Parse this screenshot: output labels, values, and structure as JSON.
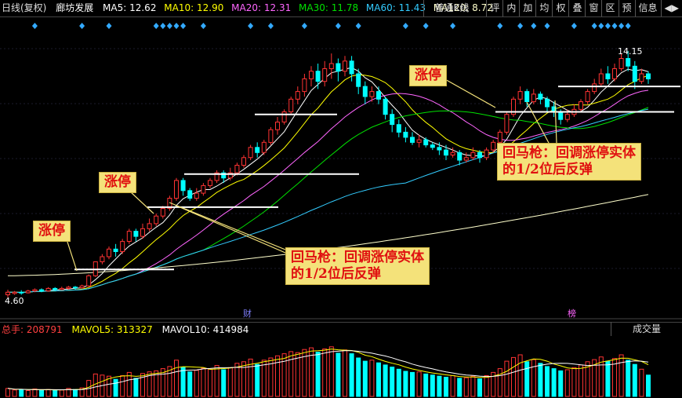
{
  "header": {
    "chart_mode": "日线(复权)",
    "stock_name": "廊坊发展",
    "ma_legend": [
      {
        "label": "MA5: 12.62",
        "color": "#ffffff"
      },
      {
        "label": "MA10: 12.90",
        "color": "#ffff00"
      },
      {
        "label": "MA20: 12.31",
        "color": "#ff66ff"
      },
      {
        "label": "MA30: 11.78",
        "color": "#00e000"
      },
      {
        "label": "MA60: 11.43",
        "color": "#33ccff"
      },
      {
        "label": "MA120: 8.72",
        "color": "#ffffcc"
      }
    ]
  },
  "toolbar": {
    "select_label": "普通K线",
    "select_icon": "caret-down-icon",
    "buttons": [
      "评",
      "内",
      "加",
      "均",
      "权",
      "叠",
      "窗",
      "区",
      "预",
      "信息"
    ],
    "arrows_label": "◀▶"
  },
  "annotations": {
    "limit_up_1": "涨停",
    "limit_up_2": "涨停",
    "limit_up_3": "涨停",
    "pullback_1_line1": "回马枪：回调涨停实体",
    "pullback_1_line2": "的1/2位后反弹",
    "pullback_2_line1": "回马枪：回调涨停实体",
    "pullback_2_line2": "的1/2位后反弹"
  },
  "volume_header": {
    "total_label": "总手: 208791",
    "mavol5_label": "MAVOL5: 313327",
    "mavol10_label": "MAVOL10: 414984",
    "select_label": "成交量"
  },
  "chart_data": {
    "type": "candlestick",
    "price_range": [
      4.6,
      15.6
    ],
    "max_label": "14.15",
    "min_label": "4.60",
    "event_markers": [
      "财",
      "榜"
    ],
    "colors": {
      "up": "#ff3333",
      "down": "#00ffff"
    },
    "candles": [
      [
        4.8,
        4.9,
        4.7,
        5.0
      ],
      [
        4.85,
        4.9,
        4.8,
        4.95
      ],
      [
        4.9,
        4.88,
        4.8,
        4.98
      ],
      [
        4.88,
        4.95,
        4.85,
        5.0
      ],
      [
        4.95,
        5.0,
        4.9,
        5.05
      ],
      [
        5.0,
        4.95,
        4.9,
        5.05
      ],
      [
        4.95,
        5.05,
        4.92,
        5.1
      ],
      [
        5.05,
        5.0,
        4.95,
        5.1
      ],
      [
        5.0,
        5.05,
        4.98,
        5.12
      ],
      [
        5.05,
        5.1,
        5.0,
        5.15
      ],
      [
        5.1,
        5.08,
        5.0,
        5.15
      ],
      [
        5.08,
        5.15,
        5.05,
        5.2
      ],
      [
        5.15,
        5.55,
        5.1,
        5.6
      ],
      [
        5.55,
        6.1,
        5.5,
        6.1
      ],
      [
        6.1,
        6.3,
        6.0,
        6.4
      ],
      [
        6.3,
        6.6,
        6.2,
        6.7
      ],
      [
        6.6,
        6.5,
        6.3,
        6.8
      ],
      [
        6.5,
        6.9,
        6.4,
        7.0
      ],
      [
        6.9,
        7.3,
        6.8,
        7.4
      ],
      [
        7.3,
        7.1,
        6.9,
        7.4
      ],
      [
        7.1,
        7.4,
        7.0,
        7.6
      ],
      [
        7.4,
        7.6,
        7.3,
        7.8
      ],
      [
        7.6,
        7.9,
        7.5,
        8.0
      ],
      [
        7.9,
        8.2,
        7.8,
        8.3
      ],
      [
        8.2,
        8.6,
        8.1,
        8.7
      ],
      [
        8.6,
        9.3,
        8.5,
        9.4
      ],
      [
        9.3,
        8.9,
        8.7,
        9.4
      ],
      [
        8.9,
        8.6,
        8.5,
        9.0
      ],
      [
        8.6,
        8.8,
        8.5,
        9.0
      ],
      [
        8.8,
        9.1,
        8.7,
        9.2
      ],
      [
        9.1,
        9.3,
        9.0,
        9.4
      ],
      [
        9.3,
        9.6,
        9.2,
        9.7
      ],
      [
        9.6,
        9.4,
        9.2,
        9.7
      ],
      [
        9.4,
        9.6,
        9.3,
        9.8
      ],
      [
        9.6,
        9.9,
        9.5,
        10.0
      ],
      [
        9.9,
        10.2,
        9.8,
        10.3
      ],
      [
        10.2,
        10.6,
        10.1,
        10.7
      ],
      [
        10.6,
        10.4,
        10.2,
        10.8
      ],
      [
        10.4,
        10.8,
        10.3,
        10.9
      ],
      [
        10.8,
        11.3,
        10.7,
        11.4
      ],
      [
        11.3,
        11.6,
        11.1,
        11.8
      ],
      [
        11.6,
        12.0,
        11.5,
        12.1
      ],
      [
        12.0,
        12.5,
        11.9,
        12.6
      ],
      [
        12.5,
        12.8,
        12.3,
        13.0
      ],
      [
        12.8,
        13.3,
        12.6,
        13.5
      ],
      [
        13.3,
        13.6,
        13.0,
        13.8
      ],
      [
        13.6,
        13.2,
        12.9,
        13.9
      ],
      [
        13.2,
        13.7,
        13.0,
        14.0
      ],
      [
        13.7,
        13.9,
        13.3,
        14.3
      ],
      [
        13.9,
        13.6,
        13.2,
        14.1
      ],
      [
        13.6,
        14.0,
        13.4,
        14.2
      ],
      [
        14.0,
        13.5,
        13.2,
        14.2
      ],
      [
        13.5,
        13.0,
        12.7,
        13.7
      ],
      [
        13.0,
        12.6,
        12.3,
        13.2
      ],
      [
        12.6,
        12.8,
        12.4,
        13.0
      ],
      [
        12.8,
        12.5,
        12.3,
        13.0
      ],
      [
        12.5,
        11.9,
        11.7,
        12.6
      ],
      [
        11.9,
        11.5,
        11.2,
        12.1
      ],
      [
        11.5,
        11.2,
        11.0,
        11.7
      ],
      [
        11.2,
        11.0,
        10.8,
        11.4
      ],
      [
        11.0,
        10.8,
        10.7,
        11.2
      ],
      [
        10.8,
        10.9,
        10.6,
        11.1
      ],
      [
        10.9,
        10.7,
        10.6,
        11.0
      ],
      [
        10.7,
        10.6,
        10.5,
        10.8
      ],
      [
        10.6,
        10.5,
        10.3,
        10.8
      ],
      [
        10.5,
        10.3,
        10.1,
        10.7
      ],
      [
        10.3,
        10.4,
        10.2,
        10.6
      ],
      [
        10.4,
        10.1,
        9.9,
        10.5
      ],
      [
        10.1,
        10.2,
        10.0,
        10.4
      ],
      [
        10.2,
        10.4,
        10.1,
        10.6
      ],
      [
        10.4,
        10.2,
        10.0,
        10.5
      ],
      [
        10.2,
        10.5,
        10.1,
        10.6
      ],
      [
        10.5,
        10.8,
        10.4,
        10.9
      ],
      [
        10.8,
        11.2,
        10.7,
        11.3
      ],
      [
        11.2,
        11.9,
        11.1,
        12.0
      ],
      [
        11.9,
        12.5,
        11.8,
        12.6
      ],
      [
        12.5,
        12.8,
        12.3,
        13.0
      ],
      [
        12.8,
        12.4,
        12.2,
        12.9
      ],
      [
        12.4,
        12.7,
        12.3,
        12.9
      ],
      [
        12.7,
        12.5,
        12.3,
        12.8
      ],
      [
        12.5,
        12.2,
        12.0,
        12.6
      ],
      [
        12.2,
        12.0,
        11.8,
        12.4
      ],
      [
        12.0,
        11.7,
        11.5,
        12.1
      ],
      [
        11.7,
        11.9,
        11.6,
        12.1
      ],
      [
        11.9,
        12.1,
        11.8,
        12.3
      ],
      [
        12.1,
        12.4,
        12.0,
        12.5
      ],
      [
        12.4,
        12.8,
        12.3,
        12.9
      ],
      [
        12.8,
        13.1,
        12.7,
        13.3
      ],
      [
        13.1,
        13.5,
        13.0,
        13.7
      ],
      [
        13.5,
        13.3,
        13.1,
        13.8
      ],
      [
        13.3,
        13.7,
        13.2,
        13.9
      ],
      [
        13.7,
        14.1,
        13.6,
        14.3
      ],
      [
        14.1,
        13.8,
        13.6,
        14.4
      ],
      [
        13.8,
        13.2,
        12.9,
        14.0
      ],
      [
        13.2,
        13.5,
        13.1,
        13.7
      ],
      [
        13.5,
        13.3,
        13.1,
        13.6
      ]
    ],
    "volume": [
      1.5,
      1.2,
      1.3,
      1.1,
      1.4,
      1.2,
      1.3,
      1.1,
      1.2,
      1.5,
      1.3,
      1.6,
      3.0,
      4.2,
      4.0,
      3.8,
      3.2,
      3.9,
      4.5,
      3.4,
      4.3,
      4.6,
      4.8,
      5.2,
      5.6,
      6.8,
      5.5,
      4.6,
      4.9,
      5.3,
      5.1,
      5.8,
      5.0,
      5.4,
      6.2,
      6.5,
      7.0,
      6.0,
      6.8,
      7.2,
      7.6,
      8.0,
      8.4,
      8.2,
      8.8,
      9.1,
      8.3,
      8.9,
      9.3,
      8.1,
      8.7,
      8.0,
      7.2,
      6.6,
      6.8,
      6.3,
      5.9,
      5.5,
      5.1,
      4.7,
      4.5,
      4.6,
      4.2,
      4.0,
      3.8,
      3.6,
      3.9,
      3.4,
      3.5,
      3.8,
      3.3,
      3.9,
      4.5,
      5.2,
      6.6,
      7.3,
      7.8,
      6.5,
      6.9,
      6.2,
      5.6,
      5.2,
      4.8,
      5.0,
      5.4,
      5.9,
      6.5,
      6.9,
      7.4,
      6.6,
      7.1,
      7.8,
      6.8,
      6.0,
      5.1,
      4.0
    ]
  }
}
